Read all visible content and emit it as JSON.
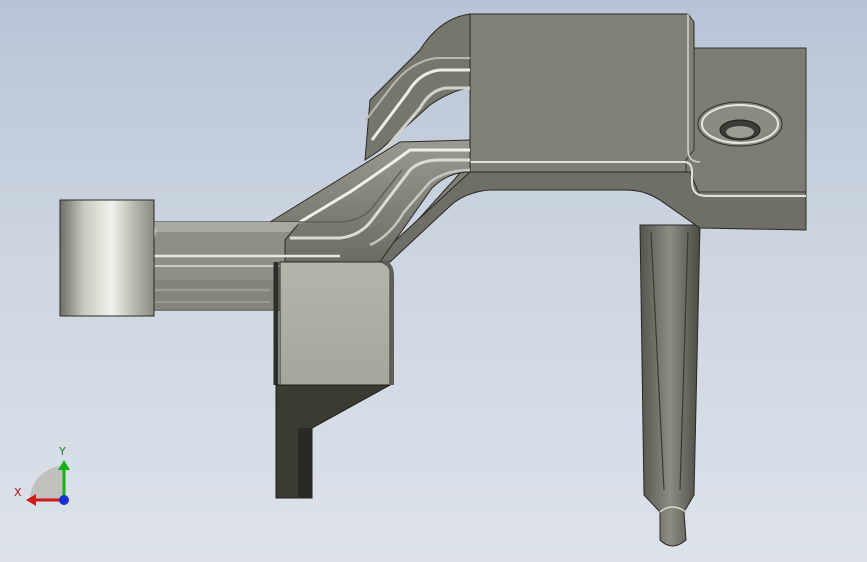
{
  "viewport": {
    "background_top": "#b8c4d6",
    "background_bottom": "#dde2ea"
  },
  "model": {
    "part_colors": {
      "dark": "#3c3c35",
      "mid": "#7f7f75",
      "light": "#c9c9c1",
      "highlight": "#eeeee8"
    }
  },
  "triad": {
    "x_label": "X",
    "y_label": "Y",
    "x_color": "#d11a1a",
    "y_color": "#18b018",
    "z_color": "#1a2fd1"
  }
}
